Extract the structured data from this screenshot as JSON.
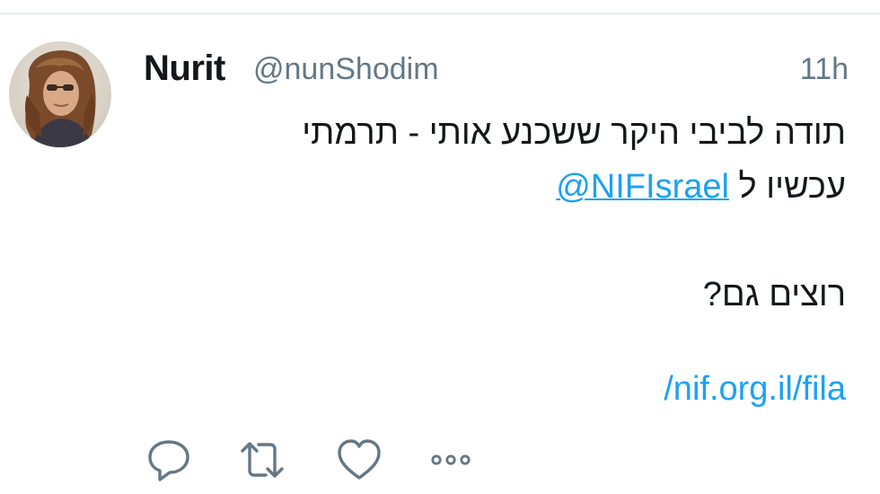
{
  "tweet": {
    "display_name": "Nurit",
    "handle": "@nunShodim",
    "timestamp": "11h",
    "text_line_1": "תודה לביבי היקר ששכנע אותי - תרמתי",
    "text_line_2_prefix": "עכשיו ל",
    "mention": "@NIFIsrael",
    "text_line_3": "רוצים גם?",
    "link": "/nif.org.il/fila"
  },
  "actions": [
    "reply-icon",
    "retweet-icon",
    "like-icon",
    "more-icon"
  ],
  "colors": {
    "link": "#1da1f2",
    "secondary_text": "#657786",
    "primary_text": "#14171a",
    "icon": "#657786",
    "divider": "#e6ecf0"
  }
}
